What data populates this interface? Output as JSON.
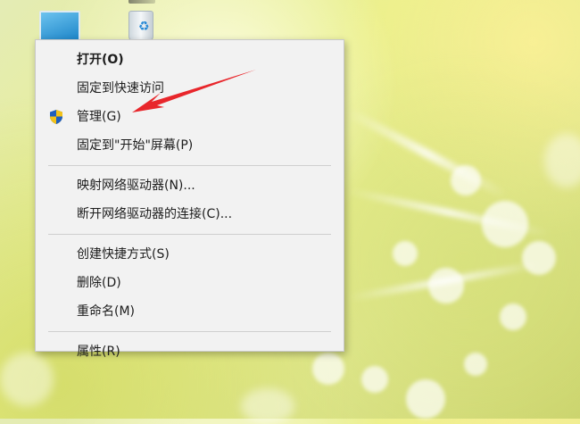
{
  "desktop": {
    "icons": [
      {
        "name": "this-pc-icon"
      },
      {
        "name": "recycle-bin-icon"
      }
    ]
  },
  "context_menu": {
    "groups": [
      [
        {
          "label": "打开(O)",
          "bold": true
        },
        {
          "label": "固定到快速访问"
        },
        {
          "label": "管理(G)",
          "icon": "uac-shield-icon"
        },
        {
          "label": "固定到\"开始\"屏幕(P)"
        }
      ],
      [
        {
          "label": "映射网络驱动器(N)..."
        },
        {
          "label": "断开网络驱动器的连接(C)..."
        }
      ],
      [
        {
          "label": "创建快捷方式(S)"
        },
        {
          "label": "删除(D)"
        },
        {
          "label": "重命名(M)"
        }
      ],
      [
        {
          "label": "属性(R)"
        }
      ]
    ]
  },
  "annotation": {
    "type": "arrow",
    "color": "#e8262b",
    "points_to": "管理(G)"
  }
}
